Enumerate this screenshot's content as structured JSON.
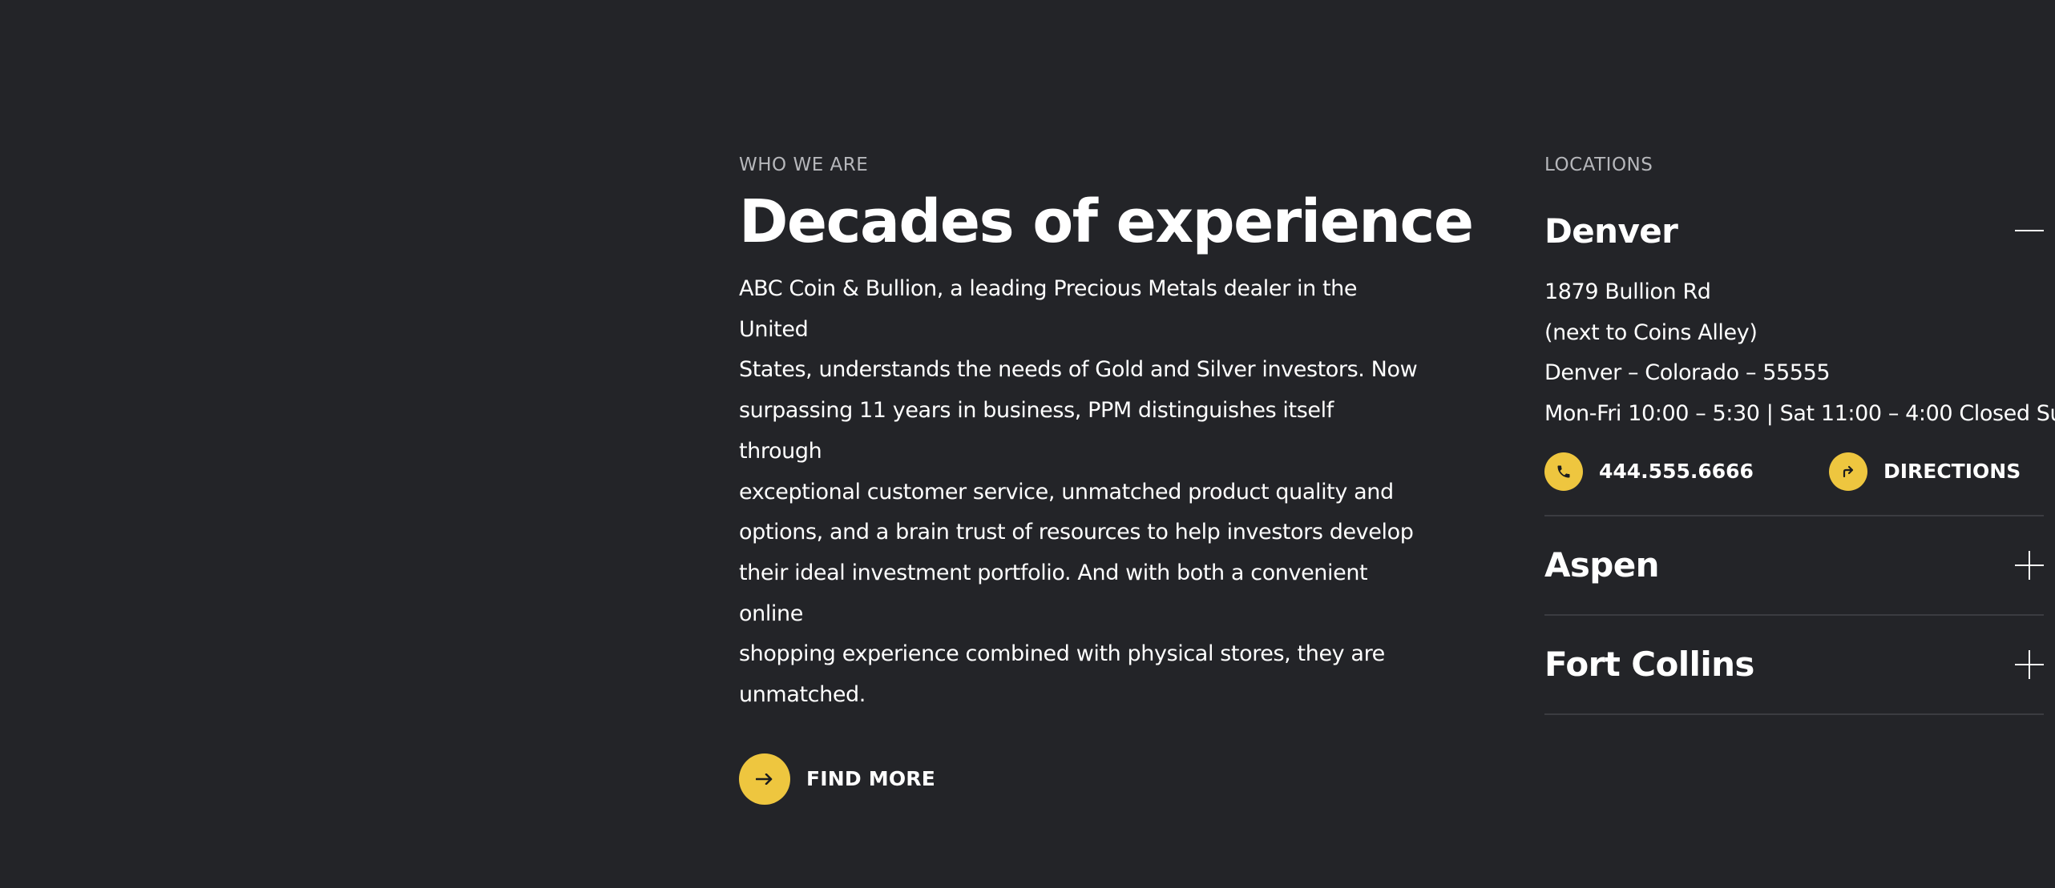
{
  "colors": {
    "background": "#232428",
    "accent": "#eec63f",
    "text": "#ffffff",
    "muted": "#b6b7bb",
    "divider": "#3b3c41"
  },
  "about": {
    "eyebrow": "WHO WE ARE",
    "title": "Decades of experience",
    "body_lines": [
      "ABC Coin & Bullion, a leading Precious Metals dealer in the United",
      "States, understands the needs of Gold and Silver investors. Now",
      "surpassing 11 years in business, PPM distinguishes itself through",
      "exceptional customer service, unmatched product quality and",
      "options, and a brain trust of resources to help investors develop",
      "their ideal investment portfolio. And with both a convenient online",
      "shopping experience combined with physical stores, they are",
      "unmatched."
    ],
    "cta": {
      "icon": "arrow-right-icon",
      "label": "FIND MORE"
    }
  },
  "locations": {
    "eyebrow": "LOCATIONS",
    "items": [
      {
        "name": "Denver",
        "expanded": true,
        "toggle_icon": "minus-icon",
        "address_lines": [
          "1879 Bullion Rd",
          "(next to Coins Alley)",
          "Denver – Colorado – 55555",
          "Mon-Fri 10:00 – 5:30 | Sat 11:00 – 4:00 Closed Su"
        ],
        "phone": {
          "icon": "phone-icon",
          "label": "444.555.6666"
        },
        "directions": {
          "icon": "directions-icon",
          "label": "DIRECTIONS"
        }
      },
      {
        "name": "Aspen",
        "expanded": false,
        "toggle_icon": "plus-icon"
      },
      {
        "name": "Fort Collins",
        "expanded": false,
        "toggle_icon": "plus-icon"
      }
    ]
  }
}
